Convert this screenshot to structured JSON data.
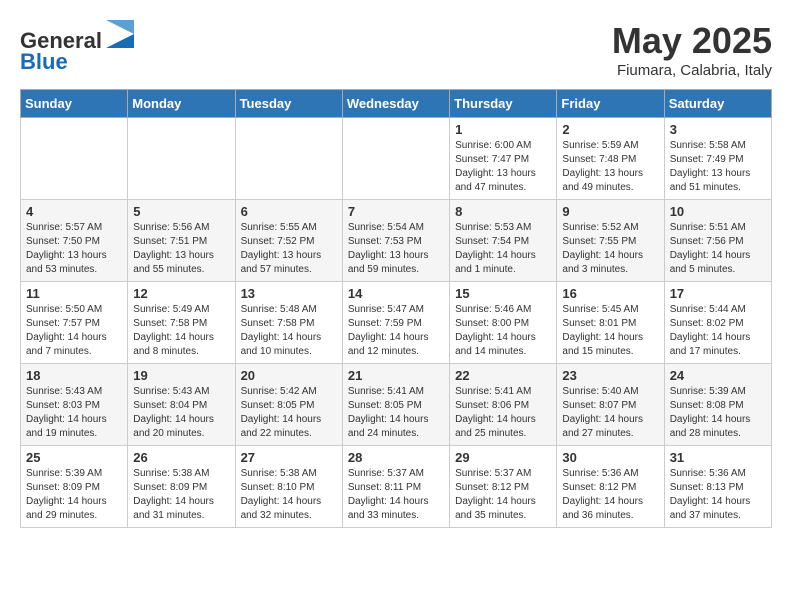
{
  "header": {
    "logo_line1": "General",
    "logo_line2": "Blue",
    "month_title": "May 2025",
    "location": "Fiumara, Calabria, Italy"
  },
  "days_of_week": [
    "Sunday",
    "Monday",
    "Tuesday",
    "Wednesday",
    "Thursday",
    "Friday",
    "Saturday"
  ],
  "weeks": [
    [
      {
        "num": "",
        "info": ""
      },
      {
        "num": "",
        "info": ""
      },
      {
        "num": "",
        "info": ""
      },
      {
        "num": "",
        "info": ""
      },
      {
        "num": "1",
        "info": "Sunrise: 6:00 AM\nSunset: 7:47 PM\nDaylight: 13 hours and 47 minutes."
      },
      {
        "num": "2",
        "info": "Sunrise: 5:59 AM\nSunset: 7:48 PM\nDaylight: 13 hours and 49 minutes."
      },
      {
        "num": "3",
        "info": "Sunrise: 5:58 AM\nSunset: 7:49 PM\nDaylight: 13 hours and 51 minutes."
      }
    ],
    [
      {
        "num": "4",
        "info": "Sunrise: 5:57 AM\nSunset: 7:50 PM\nDaylight: 13 hours and 53 minutes."
      },
      {
        "num": "5",
        "info": "Sunrise: 5:56 AM\nSunset: 7:51 PM\nDaylight: 13 hours and 55 minutes."
      },
      {
        "num": "6",
        "info": "Sunrise: 5:55 AM\nSunset: 7:52 PM\nDaylight: 13 hours and 57 minutes."
      },
      {
        "num": "7",
        "info": "Sunrise: 5:54 AM\nSunset: 7:53 PM\nDaylight: 13 hours and 59 minutes."
      },
      {
        "num": "8",
        "info": "Sunrise: 5:53 AM\nSunset: 7:54 PM\nDaylight: 14 hours and 1 minute."
      },
      {
        "num": "9",
        "info": "Sunrise: 5:52 AM\nSunset: 7:55 PM\nDaylight: 14 hours and 3 minutes."
      },
      {
        "num": "10",
        "info": "Sunrise: 5:51 AM\nSunset: 7:56 PM\nDaylight: 14 hours and 5 minutes."
      }
    ],
    [
      {
        "num": "11",
        "info": "Sunrise: 5:50 AM\nSunset: 7:57 PM\nDaylight: 14 hours and 7 minutes."
      },
      {
        "num": "12",
        "info": "Sunrise: 5:49 AM\nSunset: 7:58 PM\nDaylight: 14 hours and 8 minutes."
      },
      {
        "num": "13",
        "info": "Sunrise: 5:48 AM\nSunset: 7:58 PM\nDaylight: 14 hours and 10 minutes."
      },
      {
        "num": "14",
        "info": "Sunrise: 5:47 AM\nSunset: 7:59 PM\nDaylight: 14 hours and 12 minutes."
      },
      {
        "num": "15",
        "info": "Sunrise: 5:46 AM\nSunset: 8:00 PM\nDaylight: 14 hours and 14 minutes."
      },
      {
        "num": "16",
        "info": "Sunrise: 5:45 AM\nSunset: 8:01 PM\nDaylight: 14 hours and 15 minutes."
      },
      {
        "num": "17",
        "info": "Sunrise: 5:44 AM\nSunset: 8:02 PM\nDaylight: 14 hours and 17 minutes."
      }
    ],
    [
      {
        "num": "18",
        "info": "Sunrise: 5:43 AM\nSunset: 8:03 PM\nDaylight: 14 hours and 19 minutes."
      },
      {
        "num": "19",
        "info": "Sunrise: 5:43 AM\nSunset: 8:04 PM\nDaylight: 14 hours and 20 minutes."
      },
      {
        "num": "20",
        "info": "Sunrise: 5:42 AM\nSunset: 8:05 PM\nDaylight: 14 hours and 22 minutes."
      },
      {
        "num": "21",
        "info": "Sunrise: 5:41 AM\nSunset: 8:05 PM\nDaylight: 14 hours and 24 minutes."
      },
      {
        "num": "22",
        "info": "Sunrise: 5:41 AM\nSunset: 8:06 PM\nDaylight: 14 hours and 25 minutes."
      },
      {
        "num": "23",
        "info": "Sunrise: 5:40 AM\nSunset: 8:07 PM\nDaylight: 14 hours and 27 minutes."
      },
      {
        "num": "24",
        "info": "Sunrise: 5:39 AM\nSunset: 8:08 PM\nDaylight: 14 hours and 28 minutes."
      }
    ],
    [
      {
        "num": "25",
        "info": "Sunrise: 5:39 AM\nSunset: 8:09 PM\nDaylight: 14 hours and 29 minutes."
      },
      {
        "num": "26",
        "info": "Sunrise: 5:38 AM\nSunset: 8:09 PM\nDaylight: 14 hours and 31 minutes."
      },
      {
        "num": "27",
        "info": "Sunrise: 5:38 AM\nSunset: 8:10 PM\nDaylight: 14 hours and 32 minutes."
      },
      {
        "num": "28",
        "info": "Sunrise: 5:37 AM\nSunset: 8:11 PM\nDaylight: 14 hours and 33 minutes."
      },
      {
        "num": "29",
        "info": "Sunrise: 5:37 AM\nSunset: 8:12 PM\nDaylight: 14 hours and 35 minutes."
      },
      {
        "num": "30",
        "info": "Sunrise: 5:36 AM\nSunset: 8:12 PM\nDaylight: 14 hours and 36 minutes."
      },
      {
        "num": "31",
        "info": "Sunrise: 5:36 AM\nSunset: 8:13 PM\nDaylight: 14 hours and 37 minutes."
      }
    ]
  ]
}
